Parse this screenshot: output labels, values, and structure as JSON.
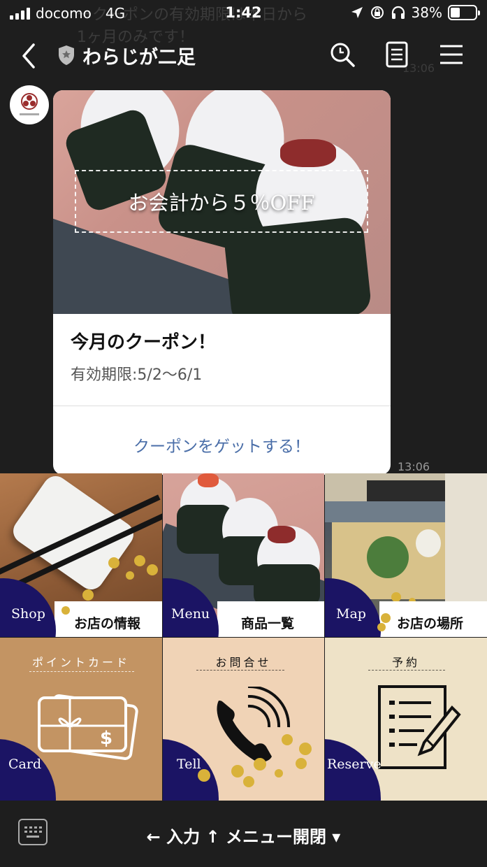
{
  "status_bar": {
    "carrier": "docomo",
    "network": "4G",
    "time": "1:42",
    "battery_percent": "38%",
    "battery_level": 0.38
  },
  "ghost_text": {
    "line1": "ークーポンの有効期限は本日から",
    "line2": "1ヶ月のみです！",
    "time": "13:06"
  },
  "header": {
    "title": "わらじが二足"
  },
  "message": {
    "banner_text": "お会計から５％OFF",
    "title": "今月のクーポン！",
    "subtitle": "有効期限:5/2〜6/1",
    "action": "クーポンをゲットする！",
    "time": "13:06"
  },
  "rich_menu": {
    "tiles": [
      {
        "en": "Shop",
        "jp": "お店の情報"
      },
      {
        "en": "Menu",
        "jp": "商品一覧"
      },
      {
        "en": "Map",
        "jp": "お店の場所"
      },
      {
        "en": "Card",
        "kicker": "ポイントカード"
      },
      {
        "en": "Tell",
        "kicker": "お問合せ"
      },
      {
        "en": "Reserve",
        "kicker": "予約"
      }
    ]
  },
  "bottom_bar": {
    "toggle_label": "← 入力 ↑ メニュー開閉 ▾"
  },
  "colors": {
    "navy": "#1b1464",
    "link": "#4a6ea8",
    "gold": "#d9b23a"
  }
}
